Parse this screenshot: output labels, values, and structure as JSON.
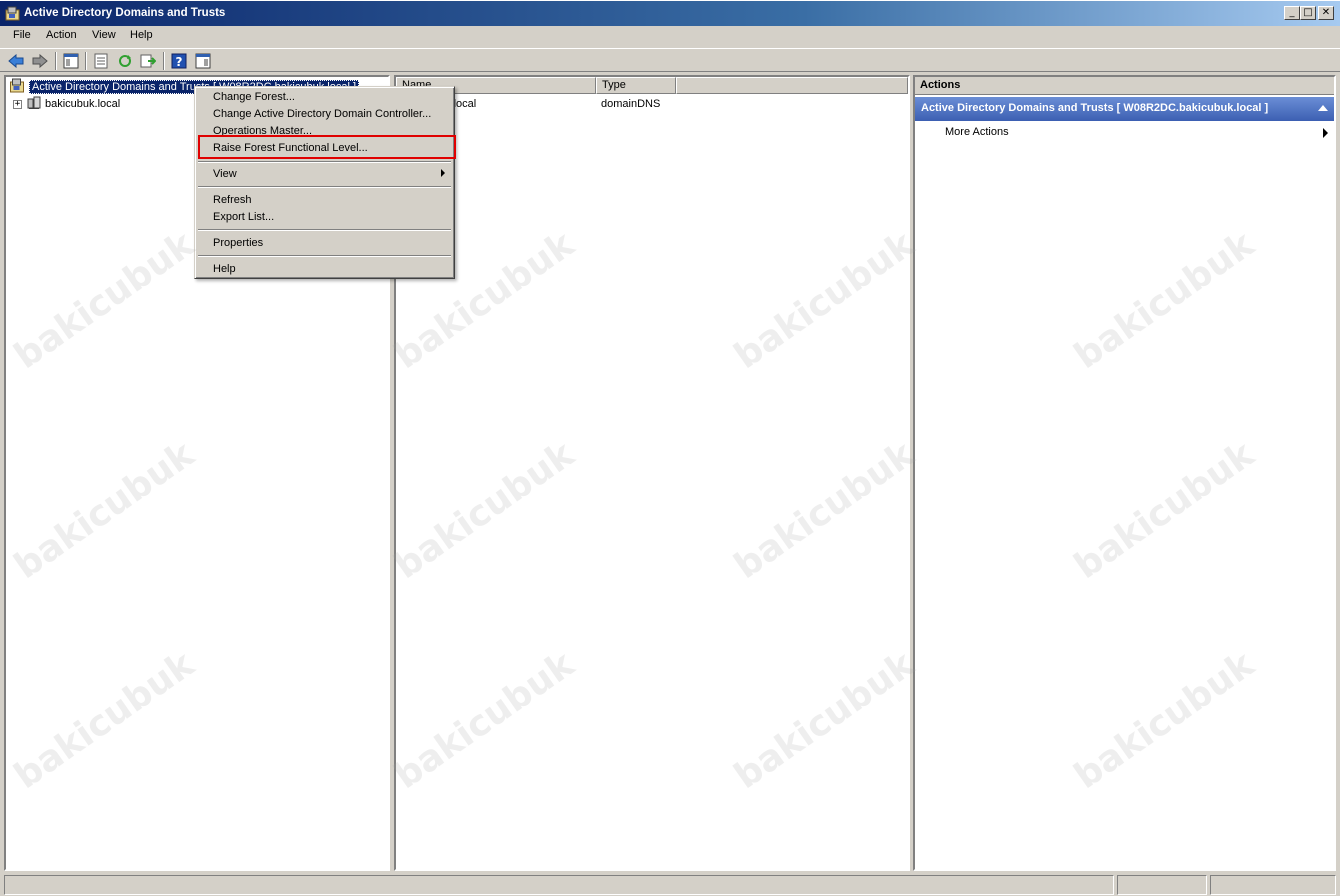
{
  "window": {
    "title": "Active Directory Domains and Trusts",
    "min": "_",
    "max": "□",
    "close": "✕"
  },
  "menu": [
    "File",
    "Action",
    "View",
    "Help"
  ],
  "tree": {
    "root_label": "Active Directory Domains and Trusts [ W08R2DC.bakicubuk.local ]",
    "child_label": "bakicubuk.local",
    "expander": "+"
  },
  "list": {
    "columns": [
      "Name",
      "Type"
    ],
    "rows": [
      {
        "name": "bakicubuk.local",
        "type": "domainDNS"
      }
    ]
  },
  "actions": {
    "header": "Actions",
    "section_title": "Active Directory Domains and Trusts [ W08R2DC.bakicubuk.local ]",
    "more_actions": "More Actions"
  },
  "context_menu": {
    "items": [
      "Change Forest...",
      "Change Active Directory Domain Controller...",
      "Operations Master...",
      "Raise Forest Functional Level...",
      "View",
      "Refresh",
      "Export List...",
      "Properties",
      "Help"
    ],
    "highlighted": "Raise Forest Functional Level..."
  },
  "watermark": "bakicubuk",
  "colors": {
    "selection": "#0a246a",
    "highlight_border": "#e00000",
    "actions_header": "#3c5fb2"
  }
}
